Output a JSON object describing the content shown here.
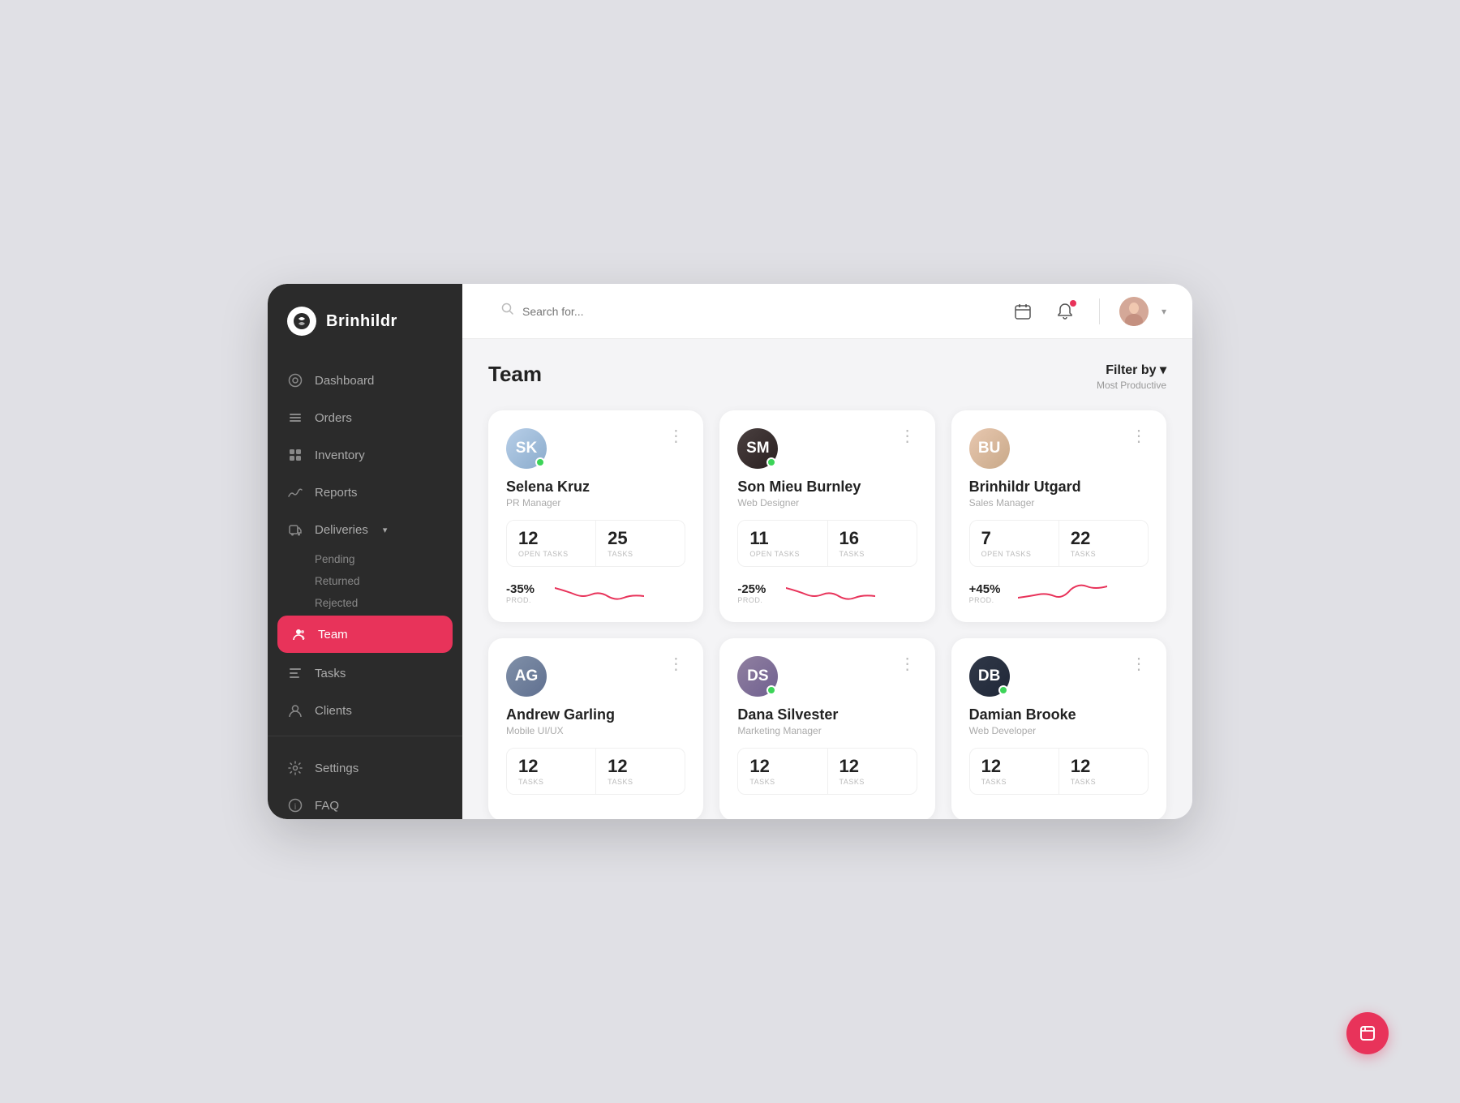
{
  "app": {
    "logo_letter": "B",
    "name": "Brinhildr"
  },
  "header": {
    "search_placeholder": "Search for..."
  },
  "sidebar": {
    "nav_items": [
      {
        "id": "dashboard",
        "label": "Dashboard",
        "icon": "⊙"
      },
      {
        "id": "orders",
        "label": "Orders",
        "icon": "≡"
      },
      {
        "id": "inventory",
        "label": "Inventory",
        "icon": "⊞"
      },
      {
        "id": "reports",
        "label": "Reports",
        "icon": "∿"
      },
      {
        "id": "deliveries",
        "label": "Deliveries",
        "icon": "◎",
        "has_arrow": true
      },
      {
        "id": "team",
        "label": "Team",
        "icon": "👥",
        "active": true
      },
      {
        "id": "tasks",
        "label": "Tasks",
        "icon": "☰"
      },
      {
        "id": "clients",
        "label": "Clients",
        "icon": "👤"
      }
    ],
    "deliveries_sub": [
      "Pending",
      "Returned",
      "Rejected"
    ],
    "bottom_items": [
      {
        "id": "settings",
        "label": "Settings",
        "icon": "⚙"
      },
      {
        "id": "faq",
        "label": "FAQ",
        "icon": "ℹ"
      }
    ]
  },
  "page": {
    "title": "Team",
    "filter_label": "Filter by ▾",
    "filter_sub": "Most Productive"
  },
  "team_cards": [
    {
      "name": "Selena Kruz",
      "role": "PR Manager",
      "open_tasks": "12",
      "open_tasks_label": "OPEN TASKS",
      "tasks": "25",
      "tasks_label": "TASKS",
      "prod_value": "-35%",
      "prod_label": "PROD.",
      "online": true,
      "avatar_initials": "SK",
      "avatar_class": "av1",
      "sparkline_positive": false
    },
    {
      "name": "Son Mieu Burnley",
      "role": "Web Designer",
      "open_tasks": "11",
      "open_tasks_label": "OPEN TASKS",
      "tasks": "16",
      "tasks_label": "TASKS",
      "prod_value": "-25%",
      "prod_label": "PROD.",
      "online": true,
      "avatar_initials": "SM",
      "avatar_class": "av2",
      "sparkline_positive": false
    },
    {
      "name": "Brinhildr Utgard",
      "role": "Sales Manager",
      "open_tasks": "7",
      "open_tasks_label": "OPEN TASKS",
      "tasks": "22",
      "tasks_label": "TASKS",
      "prod_value": "+45%",
      "prod_label": "PROD.",
      "online": false,
      "avatar_initials": "BU",
      "avatar_class": "av3",
      "sparkline_positive": true
    },
    {
      "name": "Andrew Garling",
      "role": "Mobile UI/UX",
      "open_tasks": "12",
      "open_tasks_label": "TASKS",
      "tasks": "12",
      "tasks_label": "TASKS",
      "prod_value": "",
      "prod_label": "",
      "online": false,
      "avatar_initials": "AG",
      "avatar_class": "av4",
      "sparkline_positive": false
    },
    {
      "name": "Dana Silvester",
      "role": "Marketing Manager",
      "open_tasks": "12",
      "open_tasks_label": "TASKS",
      "tasks": "12",
      "tasks_label": "TASKS",
      "prod_value": "",
      "prod_label": "",
      "online": true,
      "avatar_initials": "DS",
      "avatar_class": "av5",
      "sparkline_positive": false
    },
    {
      "name": "Damian Brooke",
      "role": "Web Developer",
      "open_tasks": "12",
      "open_tasks_label": "TASKS",
      "tasks": "12",
      "tasks_label": "TASKS",
      "prod_value": "",
      "prod_label": "",
      "online": true,
      "avatar_initials": "DB",
      "avatar_class": "av6",
      "sparkline_positive": true
    }
  ],
  "icons": {
    "search": "🔍",
    "calendar": "▣",
    "bell": "🔔",
    "chevron_down": "▾",
    "dots_vertical": "⋮",
    "fab_icon": "⊡"
  }
}
